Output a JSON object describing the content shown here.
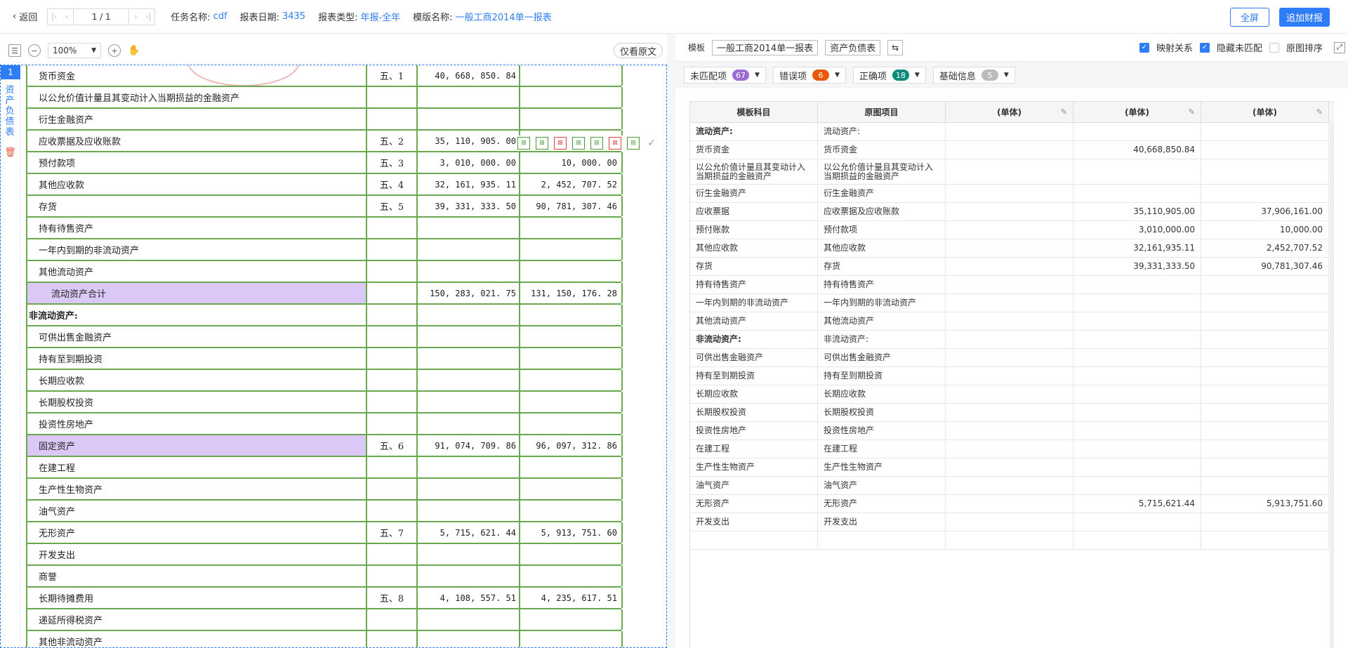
{
  "topbar": {
    "back_label": "返回",
    "page_value": "1 / 1",
    "task_label": "任务名称:",
    "task_value": "cdf",
    "date_label": "报表日期:",
    "date_value": "3435",
    "type_label": "报表类型:",
    "type_value": "年报-全年",
    "template_label": "模版名称:",
    "template_value": "一般工商2014单一报表",
    "fullscreen_label": "全屏",
    "add_report_label": "追加财报"
  },
  "left": {
    "zoom_value": "100%",
    "orig_only_label": "仅看原文",
    "page_number": "1",
    "sheet_label": "资产负债表",
    "rows": [
      {
        "label": "货币资金",
        "note": "五、1",
        "v1": "40, 668, 850. 84",
        "v2": "",
        "type": "normal"
      },
      {
        "label": "以公允价值计量且其变动计入当期损益的金融资产",
        "note": "",
        "v1": "",
        "v2": "",
        "type": "normal"
      },
      {
        "label": "衍生金融资产",
        "note": "",
        "v1": "",
        "v2": "",
        "type": "normal"
      },
      {
        "label": "应收票据及应收账款",
        "note": "五、2",
        "v1": "35, 110, 905. 00",
        "v2": "37, 906, 161. 00",
        "type": "normal"
      },
      {
        "label": "预付款项",
        "note": "五、3",
        "v1": "3, 010, 000. 00",
        "v2": "10, 000. 00",
        "type": "normal"
      },
      {
        "label": "其他应收款",
        "note": "五、4",
        "v1": "32, 161, 935. 11",
        "v2": "2, 452, 707. 52",
        "type": "normal"
      },
      {
        "label": "存货",
        "note": "五、5",
        "v1": "39, 331, 333. 50",
        "v2": "90, 781, 307. 46",
        "type": "normal"
      },
      {
        "label": "持有待售资产",
        "note": "",
        "v1": "",
        "v2": "",
        "type": "normal"
      },
      {
        "label": "一年内到期的非流动资产",
        "note": "",
        "v1": "",
        "v2": "",
        "type": "normal"
      },
      {
        "label": "其他流动资产",
        "note": "",
        "v1": "",
        "v2": "",
        "type": "normal"
      },
      {
        "label": "流动资产合计",
        "note": "",
        "v1": "150, 283, 021. 75",
        "v2": "131, 150, 176. 28",
        "type": "total"
      },
      {
        "label": "非流动资产:",
        "note": "",
        "v1": "",
        "v2": "",
        "type": "section"
      },
      {
        "label": "可供出售金融资产",
        "note": "",
        "v1": "",
        "v2": "",
        "type": "normal"
      },
      {
        "label": "持有至到期投资",
        "note": "",
        "v1": "",
        "v2": "",
        "type": "normal"
      },
      {
        "label": "长期应收款",
        "note": "",
        "v1": "",
        "v2": "",
        "type": "normal"
      },
      {
        "label": "长期股权投资",
        "note": "",
        "v1": "",
        "v2": "",
        "type": "normal"
      },
      {
        "label": "投资性房地产",
        "note": "",
        "v1": "",
        "v2": "",
        "type": "normal"
      },
      {
        "label": "固定资产",
        "note": "五、6",
        "v1": "91, 074, 709. 86",
        "v2": "96, 097, 312. 86",
        "type": "highlight"
      },
      {
        "label": "在建工程",
        "note": "",
        "v1": "",
        "v2": "",
        "type": "normal"
      },
      {
        "label": "生产性生物资产",
        "note": "",
        "v1": "",
        "v2": "",
        "type": "normal"
      },
      {
        "label": "油气资产",
        "note": "",
        "v1": "",
        "v2": "",
        "type": "normal"
      },
      {
        "label": "无形资产",
        "note": "五、7",
        "v1": "5, 715, 621. 44",
        "v2": "5, 913, 751. 60",
        "type": "normal"
      },
      {
        "label": "开发支出",
        "note": "",
        "v1": "",
        "v2": "",
        "type": "normal"
      },
      {
        "label": "商誉",
        "note": "",
        "v1": "",
        "v2": "",
        "type": "normal"
      },
      {
        "label": "长期待摊费用",
        "note": "五、8",
        "v1": "4, 108, 557. 51",
        "v2": "4, 235, 617. 51",
        "type": "normal"
      },
      {
        "label": "递延所得税资产",
        "note": "",
        "v1": "",
        "v2": "",
        "type": "normal"
      },
      {
        "label": "其他非流动资产",
        "note": "",
        "v1": "",
        "v2": "",
        "type": "normal"
      }
    ]
  },
  "right": {
    "template_label": "模板",
    "template_tag": "一般工商2014单一报表",
    "sheet_tag": "资产负债表",
    "check_mapping": "映射关系",
    "check_hide_unmatched": "隐藏未匹配",
    "check_orig_sort": "原图排序",
    "filters": [
      {
        "label": "未匹配项",
        "count": "67",
        "color": "#9b6bd6"
      },
      {
        "label": "错误项",
        "count": "6",
        "color": "#e8590c"
      },
      {
        "label": "正确项",
        "count": "18",
        "color": "#0c8a7a"
      },
      {
        "label": "基础信息",
        "count": "5",
        "color": "#bbbbbb"
      }
    ],
    "headers": [
      "模板科目",
      "原图项目",
      "(单体)",
      "(单体)",
      "(单体)"
    ],
    "rows": [
      {
        "a": "流动资产:",
        "b": "流动资产:",
        "c": "",
        "d": "",
        "e": "",
        "bold": true,
        "h": 26
      },
      {
        "a": "货币资金",
        "b": "货币资金",
        "c": "",
        "d": "40,668,850.84",
        "e": "",
        "bold": false,
        "h": 26
      },
      {
        "a": "以公允价值计量且其变动计入当期损益的金融资产",
        "b": "以公允价值计量且其变动计入当期损益的金融资产",
        "c": "",
        "d": "",
        "e": "",
        "bold": false,
        "h": 36
      },
      {
        "a": "衍生金融资产",
        "b": "衍生金融资产",
        "c": "",
        "d": "",
        "e": "",
        "bold": false,
        "h": 26
      },
      {
        "a": "应收票据",
        "b": "应收票据及应收账款",
        "c": "",
        "d": "35,110,905.00",
        "e": "37,906,161.00",
        "bold": false,
        "h": 26
      },
      {
        "a": "预付账款",
        "b": "预付款项",
        "c": "",
        "d": "3,010,000.00",
        "e": "10,000.00",
        "bold": false,
        "h": 26
      },
      {
        "a": "其他应收款",
        "b": "其他应收款",
        "c": "",
        "d": "32,161,935.11",
        "e": "2,452,707.52",
        "bold": false,
        "h": 26
      },
      {
        "a": "存货",
        "b": "存货",
        "c": "",
        "d": "39,331,333.50",
        "e": "90,781,307.46",
        "bold": false,
        "h": 26
      },
      {
        "a": "持有待售资产",
        "b": "持有待售资产",
        "c": "",
        "d": "",
        "e": "",
        "bold": false,
        "h": 26
      },
      {
        "a": "一年内到期的非流动资产",
        "b": "一年内到期的非流动资产",
        "c": "",
        "d": "",
        "e": "",
        "bold": false,
        "h": 26
      },
      {
        "a": "其他流动资产",
        "b": "其他流动资产",
        "c": "",
        "d": "",
        "e": "",
        "bold": false,
        "h": 26
      },
      {
        "a": "非流动资产:",
        "b": "非流动资产:",
        "c": "",
        "d": "",
        "e": "",
        "bold": true,
        "h": 26
      },
      {
        "a": "可供出售金融资产",
        "b": "可供出售金融资产",
        "c": "",
        "d": "",
        "e": "",
        "bold": false,
        "h": 26
      },
      {
        "a": "持有至到期投资",
        "b": "持有至到期投资",
        "c": "",
        "d": "",
        "e": "",
        "bold": false,
        "h": 26
      },
      {
        "a": "长期应收款",
        "b": "长期应收款",
        "c": "",
        "d": "",
        "e": "",
        "bold": false,
        "h": 26
      },
      {
        "a": "长期股权投资",
        "b": "长期股权投资",
        "c": "",
        "d": "",
        "e": "",
        "bold": false,
        "h": 26
      },
      {
        "a": "投资性房地产",
        "b": "投资性房地产",
        "c": "",
        "d": "",
        "e": "",
        "bold": false,
        "h": 26
      },
      {
        "a": "在建工程",
        "b": "在建工程",
        "c": "",
        "d": "",
        "e": "",
        "bold": false,
        "h": 26
      },
      {
        "a": "生产性生物资产",
        "b": "生产性生物资产",
        "c": "",
        "d": "",
        "e": "",
        "bold": false,
        "h": 26
      },
      {
        "a": "油气资产",
        "b": "油气资产",
        "c": "",
        "d": "",
        "e": "",
        "bold": false,
        "h": 26
      },
      {
        "a": "无形资产",
        "b": "无形资产",
        "c": "",
        "d": "5,715,621.44",
        "e": "5,913,751.60",
        "bold": false,
        "h": 26
      },
      {
        "a": "开发支出",
        "b": "开发支出",
        "c": "",
        "d": "",
        "e": "",
        "bold": false,
        "h": 26
      },
      {
        "a": "",
        "b": "",
        "c": "",
        "d": "",
        "e": "",
        "bold": false,
        "h": 26
      }
    ]
  }
}
